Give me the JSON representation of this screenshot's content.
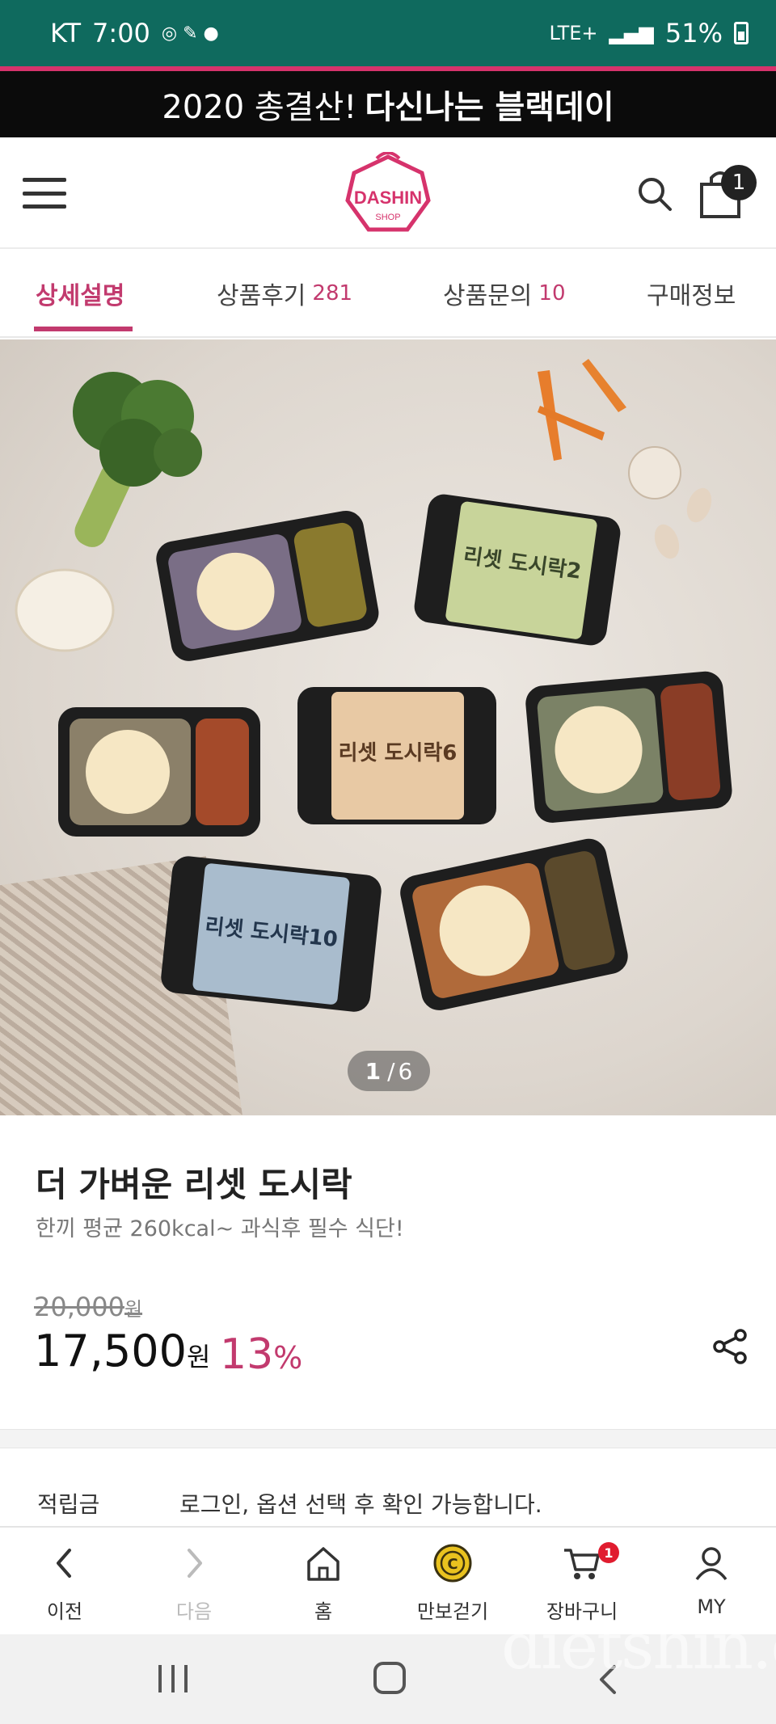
{
  "status_bar": {
    "carrier": "KT",
    "time": "7:00",
    "network": "LTE+",
    "battery": "51%"
  },
  "promo_banner": {
    "prefix": "2020 총결산!",
    "highlight": "다신나는 블랙데이"
  },
  "header": {
    "logo_text": "DASHIN",
    "logo_subtext": "SHOP",
    "cart_count": "1"
  },
  "tabs": [
    {
      "label": "상세설명",
      "count": ""
    },
    {
      "label": "상품후기",
      "count": "281"
    },
    {
      "label": "상품문의",
      "count": "10"
    },
    {
      "label": "구매정보",
      "count": ""
    }
  ],
  "gallery": {
    "current": "1",
    "separator": "/",
    "total": "6",
    "product_labels": [
      "리셋 도시락2",
      "리셋 도시락6",
      "리셋 도시락10"
    ]
  },
  "product": {
    "title": "더 가벼운 리셋 도시락",
    "subtitle": "한끼 평균 260kcal~ 과식후 필수 식단!",
    "original_price": "20,000",
    "sale_price": "17,500",
    "currency": "원",
    "discount_value": "13",
    "discount_unit": "%"
  },
  "points": {
    "label": "적립금",
    "value": "로그인, 옵션 선택 후 확인 가능합니다."
  },
  "bottom_nav": [
    {
      "label": "이전",
      "icon": "chevron-left-icon"
    },
    {
      "label": "다음",
      "icon": "chevron-right-icon"
    },
    {
      "label": "홈",
      "icon": "home-icon"
    },
    {
      "label": "만보걷기",
      "icon": "coin-icon"
    },
    {
      "label": "장바구니",
      "icon": "cart-icon",
      "badge": "1"
    },
    {
      "label": "MY",
      "icon": "user-icon"
    }
  ],
  "watermark": "dietshin.com",
  "colors": {
    "status_bar": "#0f6a5e",
    "accent": "#c23a6e",
    "banner_bg": "#0b0b0b"
  }
}
